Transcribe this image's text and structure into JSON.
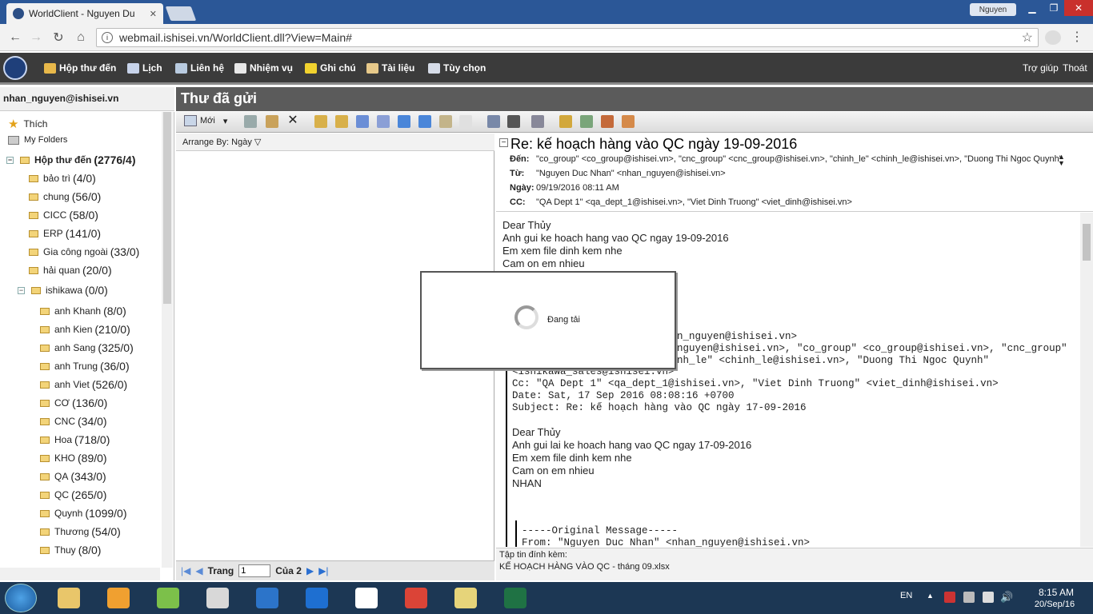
{
  "browser": {
    "tab_title": "WorldClient - Nguyen Du",
    "url": "webmail.ishisei.vn/WorldClient.dll?View=Main#",
    "user_badge": "Nguyen"
  },
  "nav": {
    "items": [
      {
        "label": "Hộp thư đến",
        "color": "#e8b84a"
      },
      {
        "label": "Lịch",
        "color": "#c7d3ea"
      },
      {
        "label": "Liên hệ",
        "color": "#b9cbe0"
      },
      {
        "label": "Nhiệm vụ",
        "color": "#e8e8e8"
      },
      {
        "label": "Ghi chú",
        "color": "#f1d22e"
      },
      {
        "label": "Tài liệu",
        "color": "#e7c98a"
      },
      {
        "label": "Tùy chọn",
        "color": "#d6dce8"
      }
    ],
    "help": "Trợ giúp",
    "logout": "Thoát"
  },
  "sidebar": {
    "user": "nhan_nguyen@ishisei.vn",
    "favorites": "Thích",
    "my_folders": "My Folders",
    "inbox": {
      "label": "Hộp thư đến",
      "count": "(2776/4)"
    },
    "folders": [
      {
        "label": "bảo trì",
        "count": "(4/0)"
      },
      {
        "label": "chung",
        "count": "(56/0)"
      },
      {
        "label": "CICC",
        "count": "(58/0)"
      },
      {
        "label": "ERP",
        "count": "(141/0)"
      },
      {
        "label": "Gia công ngoài",
        "count": "(33/0)"
      },
      {
        "label": "hải quan",
        "count": "(20/0)"
      }
    ],
    "ishikawa": {
      "label": "ishikawa",
      "count": "(0/0)"
    },
    "subfolders": [
      {
        "label": "anh Khanh",
        "count": "(8/0)"
      },
      {
        "label": "anh Kien",
        "count": "(210/0)"
      },
      {
        "label": "anh Sang",
        "count": "(325/0)"
      },
      {
        "label": "anh Trung",
        "count": "(36/0)"
      },
      {
        "label": "anh Viet",
        "count": "(526/0)"
      },
      {
        "label": "CƠ",
        "count": "(136/0)"
      },
      {
        "label": "CNC",
        "count": "(34/0)"
      },
      {
        "label": "Hoa",
        "count": "(718/0)"
      },
      {
        "label": "KHO",
        "count": "(89/0)"
      },
      {
        "label": "QA",
        "count": "(343/0)"
      },
      {
        "label": "QC",
        "count": "(265/0)"
      },
      {
        "label": "Quynh",
        "count": "(1099/0)"
      },
      {
        "label": "Thương",
        "count": "(54/0)"
      },
      {
        "label": "Thuy",
        "count": "(8/0)"
      }
    ]
  },
  "main": {
    "title": "Thư đã gửi",
    "new_button": "Mới",
    "arrange_label": "Arrange By:",
    "arrange_value": "Ngày",
    "pager": {
      "label": "Trang",
      "page": "1",
      "of": "Của 2"
    }
  },
  "message": {
    "subject": "Re: kế hoạch hàng vào QC ngày 19-09-2016",
    "to_label": "Đến:",
    "to": "\"co_group\" <co_group@ishisei.vn>, \"cnc_group\" <cnc_group@ishisei.vn>, \"chinh_le\" <chinh_le@ishisei.vn>, \"Duong Thi Ngoc Quynh\"",
    "from_label": "Từ:",
    "from": "\"Nguyen Duc Nhan\" <nhan_nguyen@ishisei.vn>",
    "date_label": "Ngày:",
    "date": "09/19/2016 08:11 AM",
    "cc_label": "CC:",
    "cc": "\"QA Dept 1\" <qa_dept_1@ishisei.vn>, \"Viet Dinh Truong\" <viet_dinh@ishisei.vn>",
    "body_top": [
      "Dear Thủy",
      "Anh gui ke hoach hang vao QC ngay 19-09-2016",
      "Em xem file dinh kem nhe",
      "Cam on em nhieu"
    ],
    "quoted_mono": [
      "n_nguyen@ishisei.vn>",
      "nguyen@ishisei.vn>, \"co_group\" <co_group@ishisei.vn>, \"cnc_group\"",
      "nh_le\" <chinh_le@ishisei.vn>, \"Duong Thi Ngoc Quynh\"",
      "<ishikawa_sales@ishisei.vn>",
      "Cc: \"QA Dept 1\" <qa_dept_1@ishisei.vn>, \"Viet Dinh Truong\" <viet_dinh@ishisei.vn>",
      "Date: Sat, 17 Sep 2016 08:08:16 +0700",
      "Subject: Re: kế hoạch hàng vào QC ngày 17-09-2016"
    ],
    "quoted_body": [
      "Dear Thủy",
      "Anh gui lai ke hoach hang vao QC ngay 17-09-2016",
      "Em xem file dinh kem nhe",
      "Cam on em nhieu",
      "NHAN"
    ],
    "nested_mono": [
      "-----Original Message-----",
      "From: \"Nguyen Duc Nhan\" <nhan_nguyen@ishisei.vn>"
    ],
    "attachment_label": "Tập tin đính kèm:",
    "attachment": "KẾ HOẠCH HÀNG VÀO QC - tháng 09.xlsx"
  },
  "loading": {
    "text": "Đang tải"
  },
  "taskbar": {
    "apps": [
      {
        "name": "explorer",
        "color": "#e9c66a"
      },
      {
        "name": "media",
        "color": "#f0a030"
      },
      {
        "name": "bluestacks",
        "color": "#7cc04a"
      },
      {
        "name": "app4",
        "color": "#d8d8d8"
      },
      {
        "name": "app5",
        "color": "#2c74c9"
      },
      {
        "name": "teamviewer",
        "color": "#1e6fd1"
      },
      {
        "name": "dropbox",
        "color": "#ffffff"
      },
      {
        "name": "chrome",
        "color": "#db4437"
      },
      {
        "name": "notes",
        "color": "#e6d47a"
      },
      {
        "name": "excel",
        "color": "#1f7244"
      }
    ],
    "lang": "EN",
    "time": "8:15 AM",
    "date": "20/Sep/16"
  }
}
